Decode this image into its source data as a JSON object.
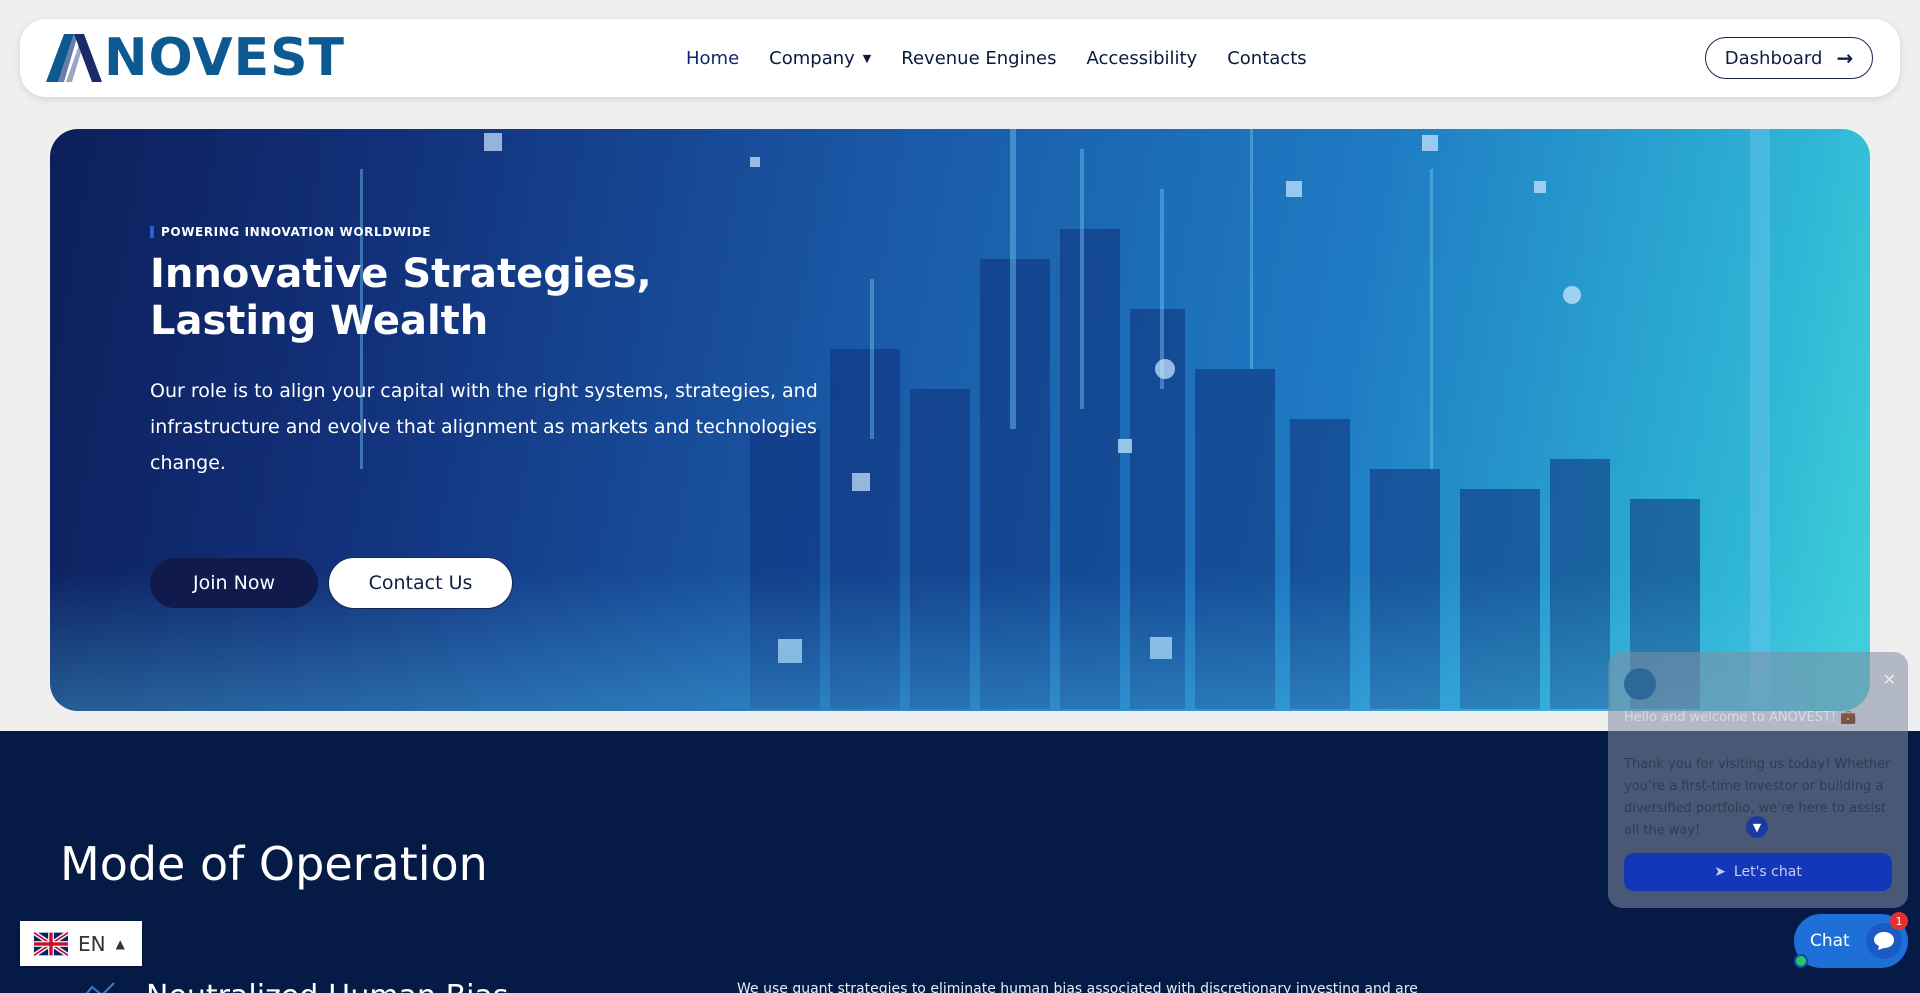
{
  "brand": {
    "logo_text": "NOVEST",
    "logo_color": "#0d5a92"
  },
  "nav": {
    "items": [
      {
        "label": "Home",
        "active": true
      },
      {
        "label": "Company",
        "has_dropdown": true
      },
      {
        "label": "Revenue Engines"
      },
      {
        "label": "Accessibility"
      },
      {
        "label": "Contacts"
      }
    ],
    "dashboard_label": "Dashboard"
  },
  "hero": {
    "tagline": "POWERING INNOVATION WORLDWIDE",
    "title": "Innovative Strategies, Lasting Wealth",
    "description": "Our role is to align your capital with the right systems, strategies, and infrastructure and evolve that alignment as markets and technologies change.",
    "primary_button": "Join Now",
    "secondary_button": "Contact Us"
  },
  "section": {
    "title": "Mode of Operation",
    "card_title": "Neutralized Human Bias",
    "card_text": "We use quant strategies to eliminate human bias associated with discretionary investing and are"
  },
  "language": {
    "code": "EN"
  },
  "chat": {
    "greeting": "Hello and welcome to ANOVEST! 💼",
    "message": "Thank you for visiting us today! Whether you’re a first-time investor or building a diversified portfolio, we’re here to assist all the way!",
    "cta_label": "Let's chat",
    "launcher_label": "Chat",
    "unread_count": "1"
  },
  "colors": {
    "primary_dark": "#101a4c",
    "section_bg": "#051a44",
    "chat_blue": "#1f6fd8"
  }
}
